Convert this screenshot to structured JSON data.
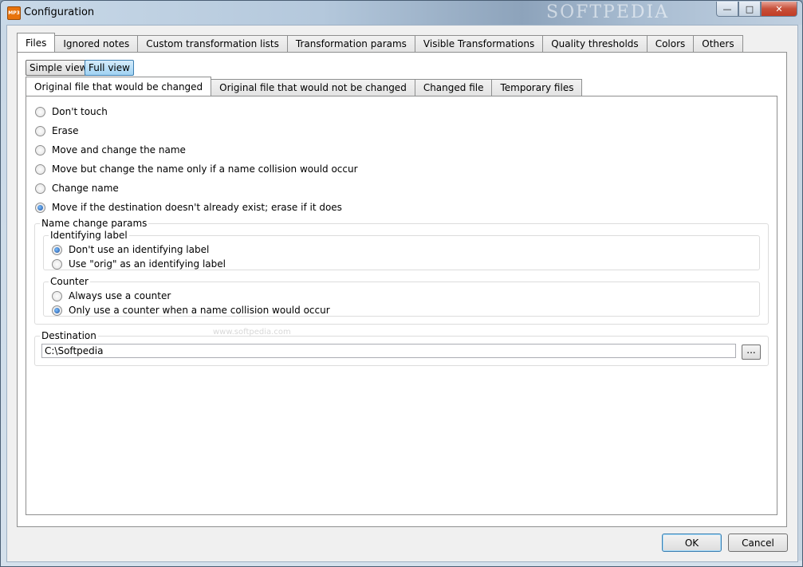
{
  "window": {
    "title": "Configuration",
    "app_icon_text": "MP3",
    "watermark": "SOFTPEDIA",
    "min_glyph": "—",
    "max_glyph": "□",
    "close_glyph": "✕"
  },
  "main_tabs": [
    {
      "label": "Files",
      "active": true
    },
    {
      "label": "Ignored notes"
    },
    {
      "label": "Custom transformation lists"
    },
    {
      "label": "Transformation params"
    },
    {
      "label": "Visible Transformations"
    },
    {
      "label": "Quality thresholds"
    },
    {
      "label": "Colors"
    },
    {
      "label": "Others"
    }
  ],
  "view_buttons": {
    "simple": "Simple view",
    "full": "Full view"
  },
  "sub_tabs": [
    {
      "label": "Original file that would be changed",
      "active": true
    },
    {
      "label": "Original file that would not be changed"
    },
    {
      "label": "Changed file"
    },
    {
      "label": "Temporary files"
    }
  ],
  "actions": [
    {
      "label": "Don't touch",
      "checked": false
    },
    {
      "label": "Erase",
      "checked": false
    },
    {
      "label": "Move and change the name",
      "checked": false
    },
    {
      "label": "Move but change the name only if a name collision would occur",
      "checked": false
    },
    {
      "label": "Change name",
      "checked": false
    },
    {
      "label": "Move if the destination doesn't already exist; erase if it does",
      "checked": true
    }
  ],
  "name_change": {
    "title": "Name change params",
    "identifying_label": {
      "title": "Identifying label",
      "options": [
        {
          "label": "Don't use an identifying label",
          "checked": true
        },
        {
          "label": "Use \"orig\" as an identifying label",
          "checked": false
        }
      ]
    },
    "counter": {
      "title": "Counter",
      "options": [
        {
          "label": "Always use a counter",
          "checked": false
        },
        {
          "label": "Only use a counter when a name collision would occur",
          "checked": true
        }
      ]
    }
  },
  "destination": {
    "title": "Destination",
    "value": "C:\\Softpedia",
    "browse_label": "..."
  },
  "watermark_mid": "www.softpedia.com",
  "footer": {
    "ok": "OK",
    "cancel": "Cancel"
  }
}
